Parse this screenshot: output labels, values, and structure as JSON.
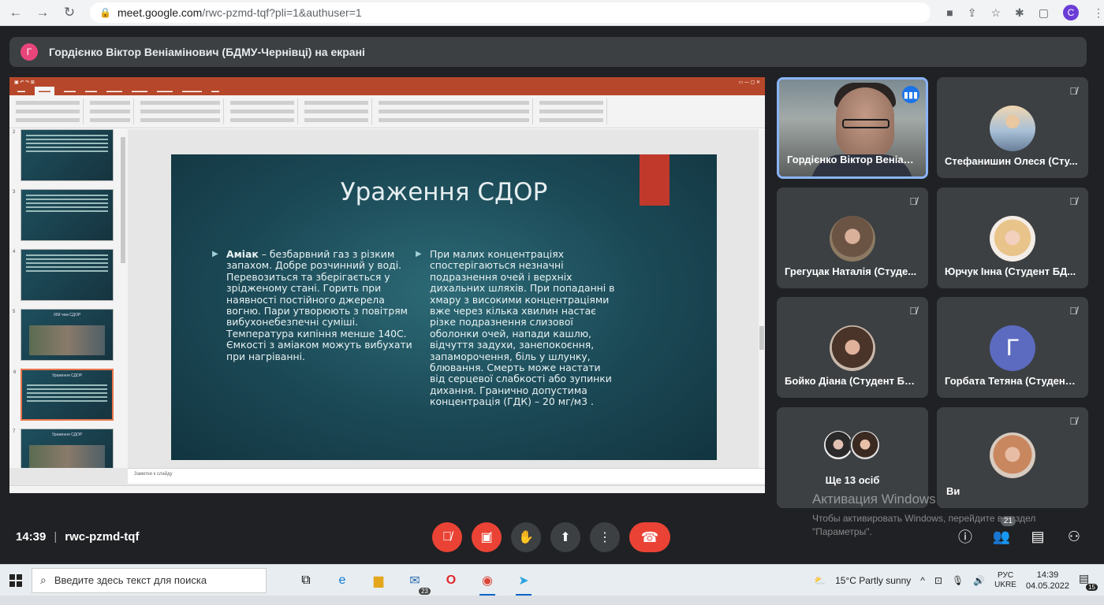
{
  "browser": {
    "url_host": "meet.google.com",
    "url_path": "/rwc-pzmd-tqf?pli=1&authuser=1",
    "profile_initial": "C",
    "icons": [
      "back-icon",
      "forward-icon",
      "reload-icon",
      "lock-icon",
      "camera-icon",
      "share-icon",
      "star-icon",
      "extensions-icon",
      "sidebar-icon",
      "menu-icon"
    ]
  },
  "banner": {
    "initial": "Г",
    "text": "Гордієнко Віктор Веніамінович (БДМУ-Чернівці) на екрані"
  },
  "slide": {
    "title": "Ураження СДОР",
    "left_bold": "Аміак",
    "left_text": " – безбарвний газ з різким запахом. Добре розчинний у воді. Перевозиться та зберігається у зрідженому стані. Горить при наявності постійного джерела вогню. Пари утворюють з повітрям вибухонебезпечні суміші. Температура кипіння менше 140С. Ємкості з аміаком можуть вибухати при нагріванні.",
    "right_text": "При малих концентраціях спостерігаються незначні подразнення очей і верхніх дихальних шляхів. При попаданні в хмару з високими концентраціями вже через кілька хвилин настає різке подразнення слизової оболонки очей, напади кашлю, відчуття задухи, занепокоєння, запаморочення, біль у шлунку, блювання. Смерть може настати від серцевої слабкості або зупинки дихання. Гранично допустима концентрація (ГДК) – 20 мг/м3 .",
    "notes_placeholder": "Заметки к слайду",
    "thumb_numbers": [
      "2",
      "3",
      "4",
      "5",
      "6",
      "7"
    ],
    "thumb5_title": "ХІМ чем СДОР",
    "thumb6_title": "Ураження СДОР",
    "thumb7_title": "Ураження СДОР"
  },
  "participants": [
    {
      "name": "Гордієнко Віктор Веніам..."
    },
    {
      "name": "Стефанишин Олеся (Сту..."
    },
    {
      "name": "Грегуцак Наталія (Студе..."
    },
    {
      "name": "Юрчук Інна (Студент БД..."
    },
    {
      "name": "Бойко Діана (Студент БД..."
    },
    {
      "name": "Горбата Тетяна (Студент ...",
      "initial": "Г"
    },
    {
      "name": "Ще 13 осіб"
    },
    {
      "name": "Ви"
    }
  ],
  "watermark": {
    "title": "Активация Windows",
    "line1": "Чтобы активировать Windows, перейдите в раздел",
    "line2": "\"Параметры\"."
  },
  "meeting": {
    "time": "14:39",
    "code": "rwc-pzmd-tqf",
    "people_count": "21"
  },
  "taskbar": {
    "search_placeholder": "Введите здесь текст для поиска",
    "mail_badge": "23",
    "weather": "15°C  Partly sunny",
    "lang_top": "РУС",
    "lang_bottom": "UKRE",
    "clock_time": "14:39",
    "clock_date": "04.05.2022",
    "notif_count": "15"
  },
  "colors": {
    "meet_bg": "#202124",
    "tile_bg": "#3c4043",
    "danger": "#ea4335",
    "speaking": "#1a73e8",
    "ppt_accent": "#b7472a"
  }
}
